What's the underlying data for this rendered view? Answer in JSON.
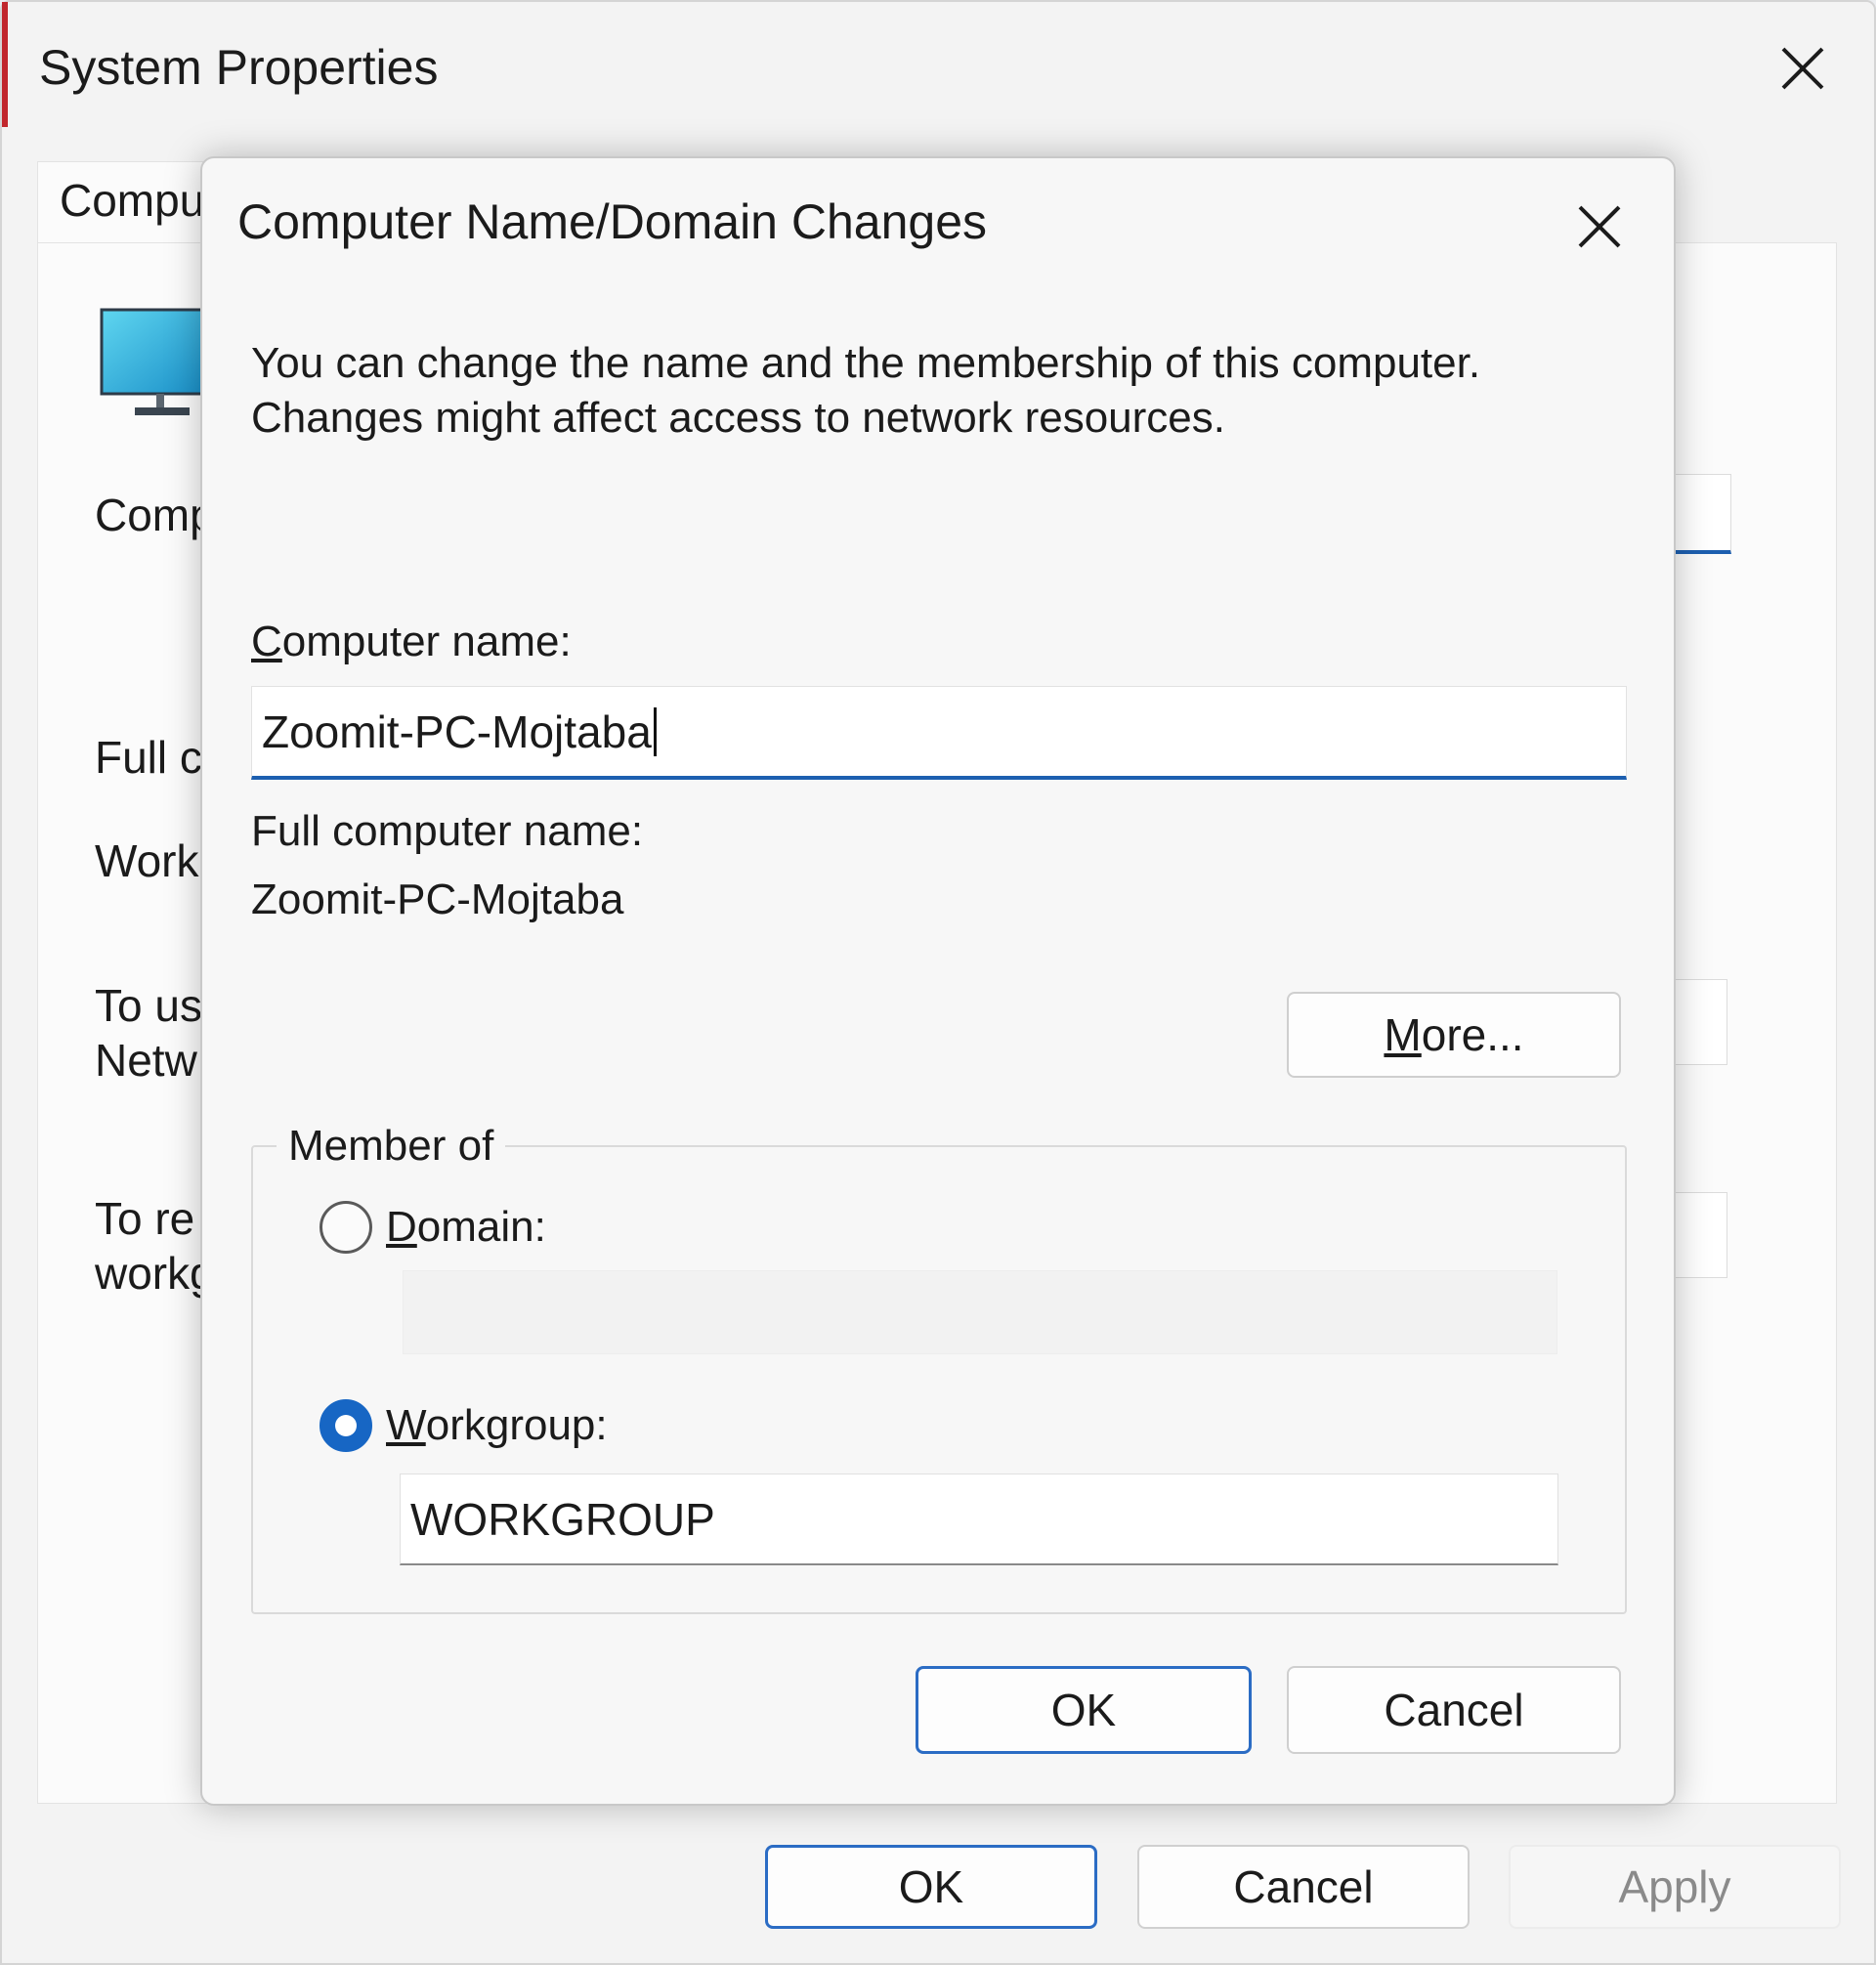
{
  "system_properties": {
    "title": "System Properties",
    "tab_label": "Compu",
    "partial_lines": [
      "Comp",
      "Full c",
      "Work",
      "To us",
      "Netw",
      "To re",
      "workg"
    ],
    "buttons": {
      "ok": "OK",
      "cancel": "Cancel",
      "apply": "Apply"
    }
  },
  "dialog": {
    "title": "Computer Name/Domain Changes",
    "description_line1": "You can change the name and the membership of this computer.",
    "description_line2": "Changes might affect access to network resources.",
    "computer_name_label_first": "C",
    "computer_name_label_rest": "omputer name:",
    "computer_name_value": "Zoomit-PC-Mojtaba",
    "full_name_label": "Full computer name:",
    "full_name_value": "Zoomit-PC-Mojtaba",
    "more_first": "M",
    "more_rest": "ore...",
    "member_of_label": "Member of",
    "domain_first": "D",
    "domain_rest": "omain:",
    "domain_value": "",
    "workgroup_first": "W",
    "workgroup_rest": "orkgroup:",
    "workgroup_value": "WORKGROUP",
    "selected_membership": "workgroup",
    "ok_label": "OK",
    "cancel_label": "Cancel"
  },
  "icons": [
    "close-icon",
    "monitor-icon",
    "radio-icon"
  ],
  "colors": {
    "accent": "#1766c4",
    "input_underline": "#1d5fb0",
    "window_accent": "#c1272d"
  }
}
